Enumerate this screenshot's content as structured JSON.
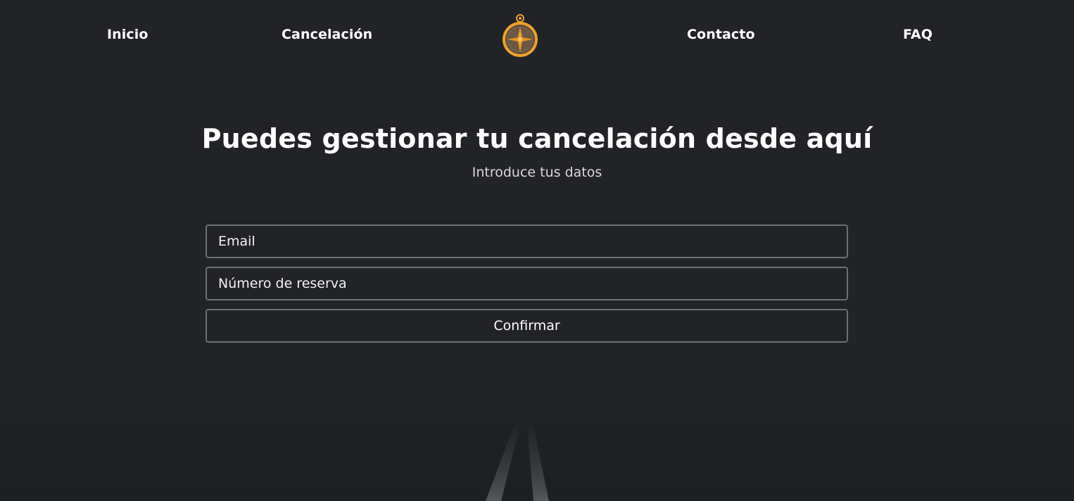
{
  "nav": {
    "items": [
      {
        "label": "Inicio"
      },
      {
        "label": "Cancelación"
      },
      {
        "label": "Contacto"
      },
      {
        "label": "FAQ"
      }
    ],
    "logo_icon": "compass-icon"
  },
  "hero": {
    "title": "Puedes gestionar tu cancelación desde aquí",
    "subtitle": "Introduce tus datos"
  },
  "form": {
    "email_placeholder": "Email",
    "reservation_placeholder": "Número de reserva",
    "submit_label": "Confirmar"
  },
  "colors": {
    "background": "#212327",
    "text": "#ffffff",
    "border": "#6e6f73",
    "accent": "#f0a028"
  }
}
